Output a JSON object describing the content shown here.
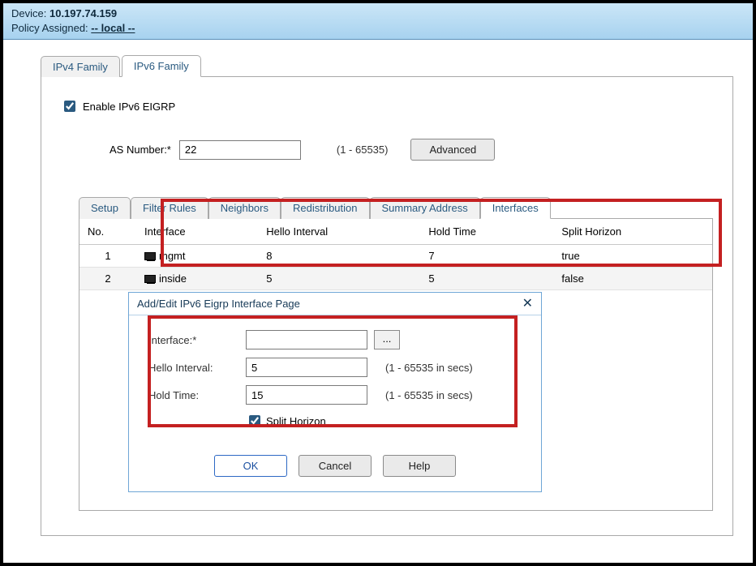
{
  "header": {
    "device_label": "Device:",
    "device_value": "10.197.74.159",
    "policy_label": "Policy Assigned:",
    "policy_value": "-- local --"
  },
  "tabs": {
    "ipv4": "IPv4 Family",
    "ipv6": "IPv6 Family"
  },
  "enable": {
    "label": "Enable IPv6 EIGRP",
    "checked": true
  },
  "as": {
    "label": "AS Number:*",
    "value": "22",
    "range": "(1 - 65535)",
    "advanced": "Advanced"
  },
  "inner_tabs": {
    "setup": "Setup",
    "filter": "Filter Rules",
    "neighbors": "Neighbors",
    "redistribution": "Redistribution",
    "summary": "Summary Address",
    "interfaces": "Interfaces"
  },
  "table": {
    "cols": {
      "no": "No.",
      "iface": "Interface",
      "hello": "Hello Interval",
      "hold": "Hold Time",
      "split": "Split Horizon"
    },
    "rows": [
      {
        "no": "1",
        "iface": "mgmt",
        "hello": "8",
        "hold": "7",
        "split": "true"
      },
      {
        "no": "2",
        "iface": "inside",
        "hello": "5",
        "hold": "5",
        "split": "false"
      }
    ]
  },
  "dialog": {
    "title": "Add/Edit IPv6 Eigrp Interface Page",
    "iface_label": "Interface:*",
    "iface_value": "",
    "hello_label": "Hello Interval:",
    "hello_value": "5",
    "hello_hint": "(1 - 65535 in secs)",
    "hold_label": "Hold Time:",
    "hold_value": "15",
    "hold_hint": "(1 - 65535 in secs)",
    "split_label": "Split Horizon",
    "split_checked": true,
    "ok": "OK",
    "cancel": "Cancel",
    "help": "Help",
    "close": "✕",
    "ellipsis": "..."
  }
}
